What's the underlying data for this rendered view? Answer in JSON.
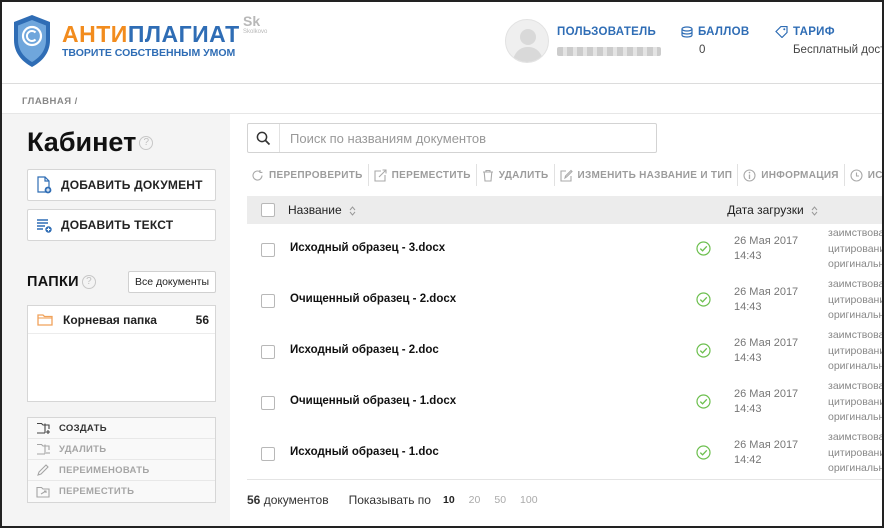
{
  "header": {
    "logo_part1": "АНТИ",
    "logo_part2": "ПЛАГИАТ",
    "logo_sub": "ТВОРИТЕ СОБСТВЕННЫМ УМОМ",
    "partner_logo_text": "Sk",
    "partner_logo_sub": "Skolkovo",
    "user_label": "ПОЛЬЗОВАТЕЛЬ",
    "balls_label": "БАЛЛОВ",
    "balls_value": "0",
    "tarif_label": "ТАРИФ",
    "tarif_value": "Бесплатный доступ"
  },
  "breadcrumb": {
    "home": "ГЛАВНАЯ",
    "sep": "/"
  },
  "sidebar": {
    "title": "Кабинет",
    "help": "?",
    "add_document": "ДОБАВИТЬ ДОКУМЕНТ",
    "add_text": "ДОБАВИТЬ ТЕКСТ",
    "folders_title": "ПАПКИ",
    "all_documents": "Все документы",
    "folders": [
      {
        "name": "Корневая папка",
        "count": "56"
      }
    ],
    "folder_actions": [
      {
        "label": "СОЗДАТЬ",
        "icon": "folder-add-icon",
        "enabled": true
      },
      {
        "label": "УДАЛИТЬ",
        "icon": "folder-delete-icon",
        "enabled": false
      },
      {
        "label": "ПЕРЕИМЕНОВАТЬ",
        "icon": "pencil-icon",
        "enabled": false
      },
      {
        "label": "ПЕРЕМЕСТИТЬ",
        "icon": "folder-move-icon",
        "enabled": false
      }
    ]
  },
  "main": {
    "search_placeholder": "Поиск по названиям документов",
    "toolbar": [
      {
        "label": "ПЕРЕПРОВЕРИТЬ",
        "icon": "refresh-icon"
      },
      {
        "label": "ПЕРЕМЕСТИТЬ",
        "icon": "move-icon"
      },
      {
        "label": "УДАЛИТЬ",
        "icon": "trash-icon"
      },
      {
        "label": "ИЗМЕНИТЬ НАЗВАНИЕ И ТИП",
        "icon": "edit-icon"
      },
      {
        "label": "ИНФОРМАЦИЯ",
        "icon": "info-icon"
      },
      {
        "label": "ИСТОРИЯ ОТЧЕТОВ",
        "icon": "history-icon"
      }
    ],
    "columns": {
      "name": "Название",
      "date": "Дата загрузки"
    },
    "documents": [
      {
        "name": "Исходный образец - 3.docx",
        "date": "26 Мая 2017",
        "time": "14:43",
        "desc": [
          "заимствования",
          "цитирования",
          "оригинальность"
        ]
      },
      {
        "name": "Очищенный образец - 2.docx",
        "date": "26 Мая 2017",
        "time": "14:43",
        "desc": [
          "заимствования",
          "цитирования",
          "оригинальность"
        ]
      },
      {
        "name": "Исходный образец - 2.doc",
        "date": "26 Мая 2017",
        "time": "14:43",
        "desc": [
          "заимствования",
          "цитирования",
          "оригинальность"
        ]
      },
      {
        "name": "Очищенный образец - 1.docx",
        "date": "26 Мая 2017",
        "time": "14:43",
        "desc": [
          "заимствования",
          "цитирования",
          "оригинальность"
        ]
      },
      {
        "name": "Исходный образец - 1.doc",
        "date": "26 Мая 2017",
        "time": "14:42",
        "desc": [
          "заимствования",
          "цитирования",
          "оригинальность"
        ]
      }
    ],
    "footer": {
      "count_number": "56",
      "count_label": "документов",
      "show_label": "Показывать по",
      "page_sizes": [
        "10",
        "20",
        "50",
        "100"
      ],
      "active_page_size": "10"
    }
  },
  "colors": {
    "brand_blue": "#2f6db5",
    "brand_orange": "#f28c1e",
    "success_green": "#6cbf4e",
    "folder_orange": "#f0a25a"
  }
}
